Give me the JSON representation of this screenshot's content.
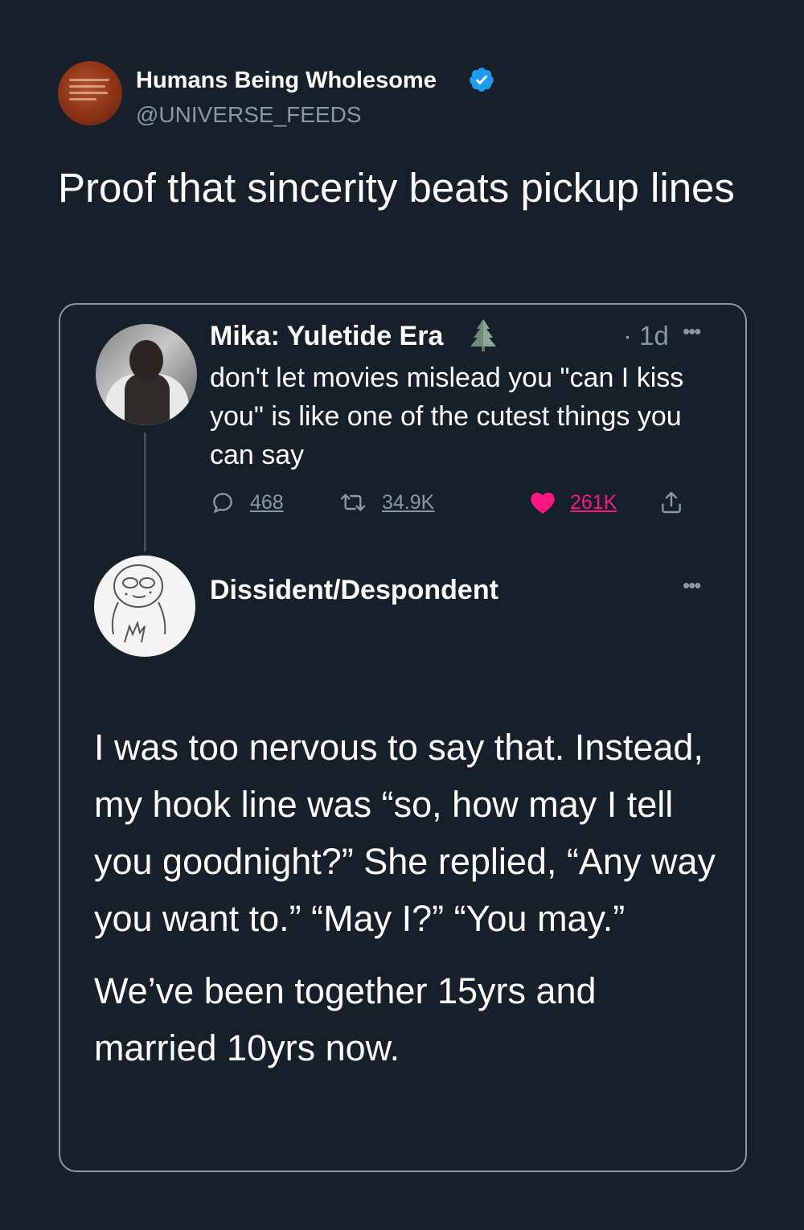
{
  "account": {
    "display_name": "Humans Being Wholesome",
    "handle": "@UNIVERSE_FEEDS",
    "verified_icon": "verified-badge-icon"
  },
  "tweet": {
    "text": "Proof that sincerity beats pickup lines"
  },
  "quoted": {
    "original": {
      "name": "Mika: Yuletide Era",
      "name_icon": "christmas-tree-icon",
      "age": "· 1d",
      "more_icon": "more-icon",
      "text": "don't let movies mislead you \"can I kiss you\" is like one of the cutest things you can say",
      "replies": "468",
      "retweets": "34.9K",
      "likes": "261K",
      "like_color": "#f91880"
    },
    "reply": {
      "name": "Dissident/Despondent",
      "paragraph_1": "I was too nervous to say that. Instead, my hook line was “so, how may I tell you goodnight?” She replied, “Any way you want to.” “May I?” “You may.”",
      "paragraph_2": "We’ve been together 15yrs and married 10yrs now."
    }
  },
  "colors": {
    "background": "#15202b",
    "secondary_text": "#8899a6",
    "verified": "#1d9bf0"
  }
}
